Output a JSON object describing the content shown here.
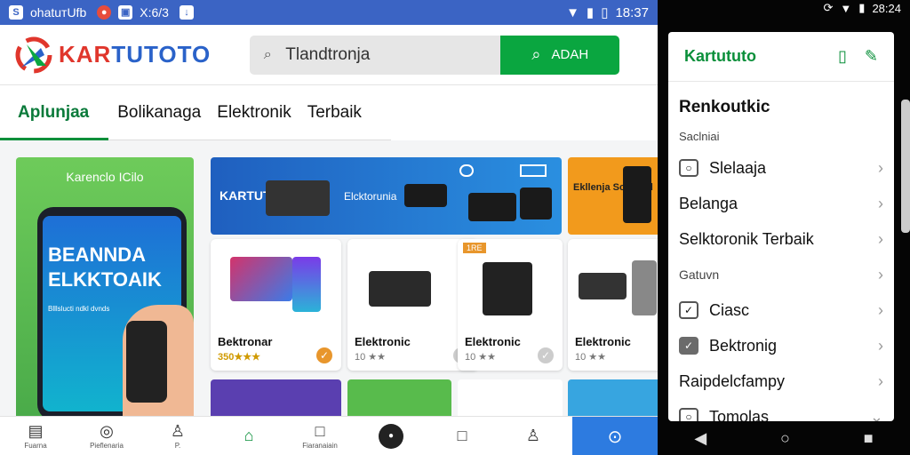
{
  "status_left": {
    "t1": "ohatuтUfb",
    "t2": "X:6/3",
    "time": "18:37"
  },
  "header": {
    "logo_a": "KAR",
    "logo_b": "TUTOTO",
    "search_value": "Tlandtronja",
    "search_button": "ADAH"
  },
  "tabs": [
    "Aplunjaa",
    "Bolikanaga",
    "Elektronik",
    "Terbaik"
  ],
  "promo": {
    "label": "Karenclo ICilo",
    "big": "BEANNDA ELKKTOAIK",
    "small": "Blllslucti ndkl dvnds"
  },
  "banner": {
    "b1": "KARTUTD",
    "b2": "Elcktorunia"
  },
  "banner2": {
    "t": "Ekllenja Scedlcid"
  },
  "cards": [
    {
      "name": "Bektronar",
      "price": "350★★★",
      "check_color": "orange"
    },
    {
      "name": "Elektronic",
      "price": "10 ★★",
      "check_color": "gray"
    },
    {
      "name": "Elektronic",
      "price": "10 ★★",
      "badge": "1RE",
      "check_color": "gray"
    },
    {
      "name": "Elektronic",
      "price": "10 ★★",
      "check_color": "gray"
    }
  ],
  "bottom_nav": [
    {
      "icon": "menu-icon",
      "label": "Fuarna"
    },
    {
      "icon": "circle-icon",
      "label": "Pieflenaria"
    },
    {
      "icon": "user-icon",
      "label": "P."
    },
    {
      "icon": "bag-icon",
      "label": ""
    },
    {
      "icon": "square-icon",
      "label": "Fiaranaiain"
    },
    {
      "icon": "dot-icon",
      "label": ""
    },
    {
      "icon": "square2-icon",
      "label": ""
    },
    {
      "icon": "profile-icon",
      "label": ""
    }
  ],
  "right": {
    "time": "28:24",
    "panel_logo": "Kartututo",
    "heading": "Renkoutkic",
    "sub": "Saclniai",
    "items": [
      {
        "label": "Slelaaja",
        "box": "outline"
      },
      {
        "label": "Belanga",
        "box": "none"
      },
      {
        "label": "Selktoronik Terbaik",
        "box": "none"
      },
      {
        "label": "Gatuvn",
        "box": "small"
      },
      {
        "label": "Ciasc",
        "box": "check"
      },
      {
        "label": "Bektronig",
        "box": "filled"
      },
      {
        "label": "Raipdelcfampy",
        "box": "none"
      },
      {
        "label": "Tomolas",
        "box": "outline"
      }
    ]
  },
  "colors": {
    "accent": "#0aa640",
    "status": "#3b64c4",
    "brand_red": "#e0362c"
  }
}
